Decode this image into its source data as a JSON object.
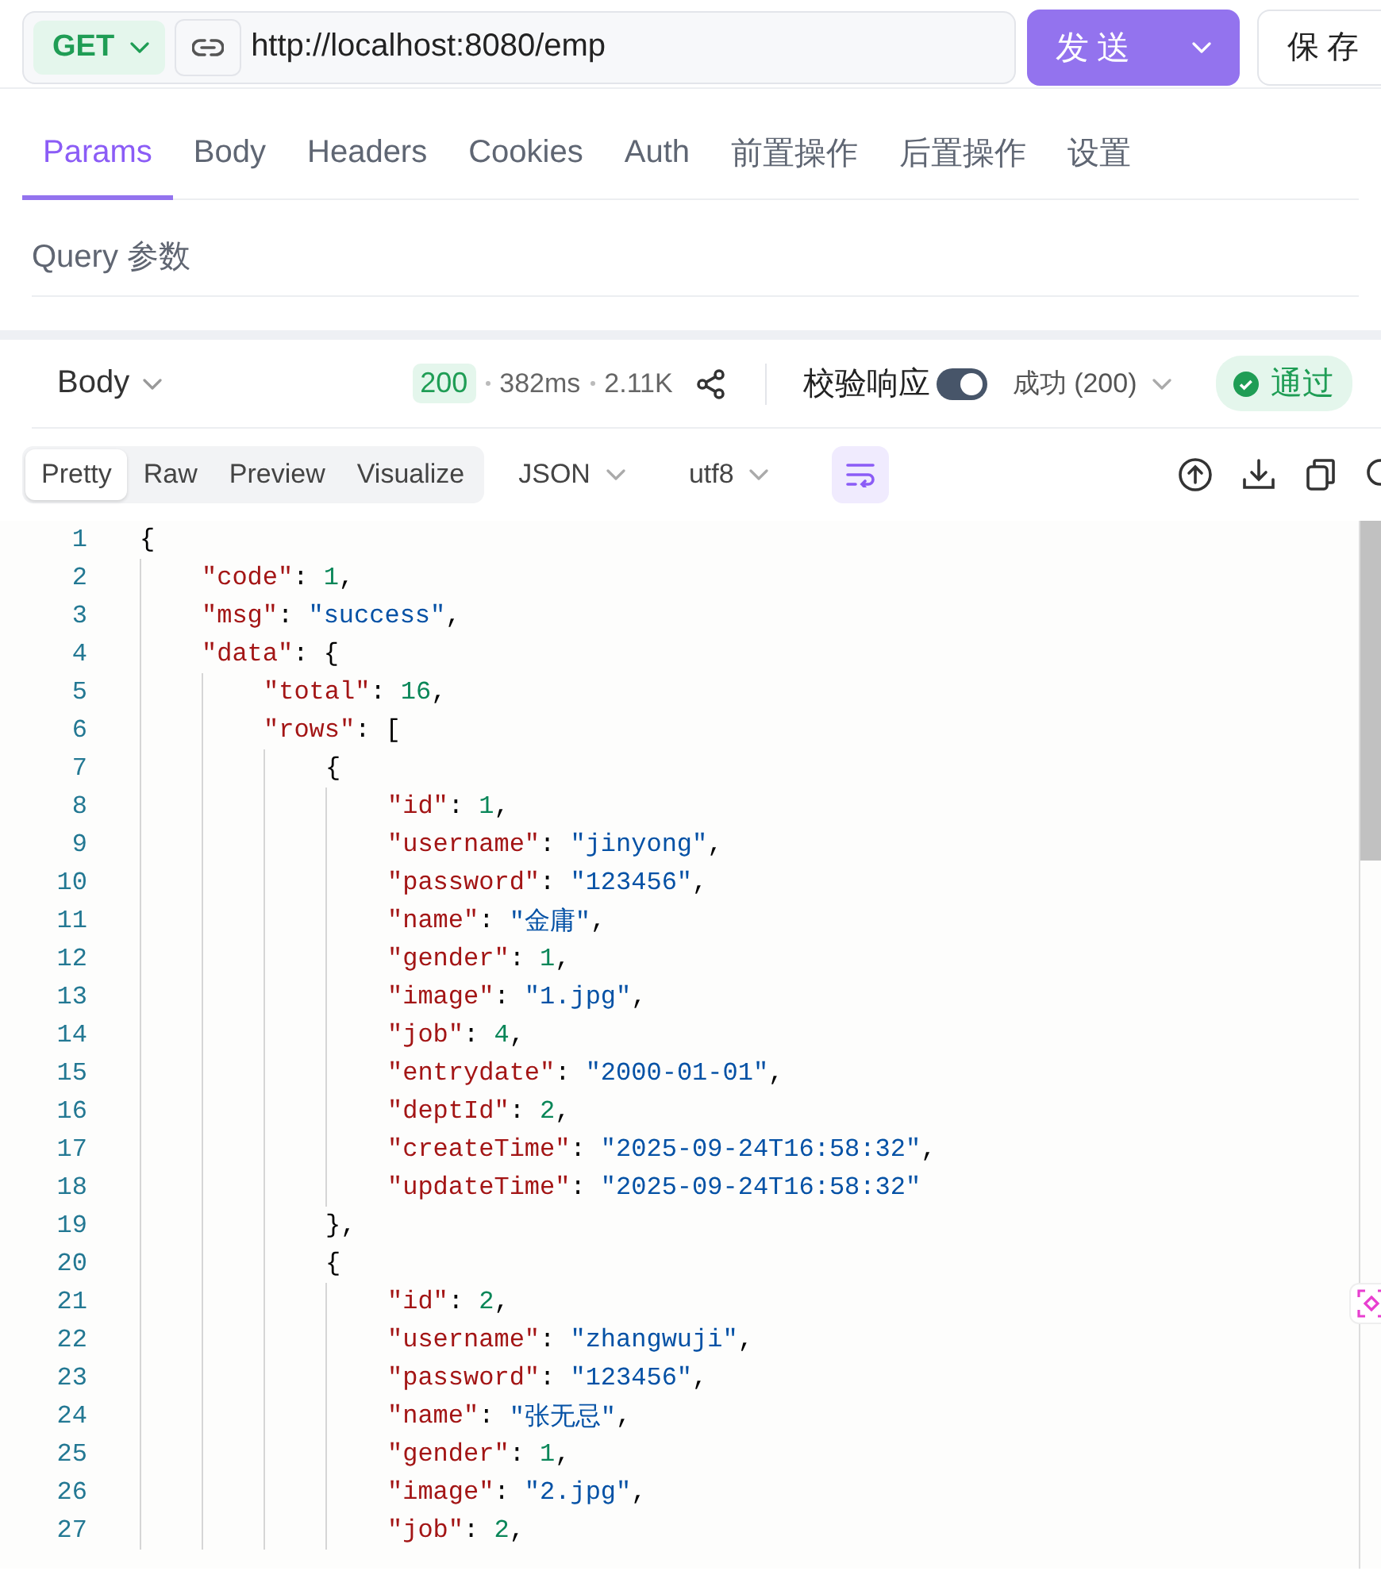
{
  "request": {
    "method": "GET",
    "url": "http://localhost:8080/emp",
    "send_label": "发送",
    "save_label": "保存"
  },
  "tabs": [
    {
      "label": "Params",
      "selected": true
    },
    {
      "label": "Body",
      "selected": false
    },
    {
      "label": "Headers",
      "selected": false
    },
    {
      "label": "Cookies",
      "selected": false
    },
    {
      "label": "Auth",
      "selected": false
    },
    {
      "label": "前置操作",
      "selected": false
    },
    {
      "label": "后置操作",
      "selected": false
    },
    {
      "label": "设置",
      "selected": false
    }
  ],
  "section_title": "Query 参数",
  "response": {
    "body_label": "Body",
    "status": "200",
    "time": "382ms",
    "size": "2.11K",
    "validate_label": "校验响应",
    "validate_on": true,
    "expect": "成功 (200)",
    "result": "通过"
  },
  "view_modes": [
    {
      "label": "Pretty",
      "selected": true
    },
    {
      "label": "Raw",
      "selected": false
    },
    {
      "label": "Preview",
      "selected": false
    },
    {
      "label": "Visualize",
      "selected": false
    }
  ],
  "format": "JSON",
  "encoding": "utf8",
  "wrap_on": true,
  "code_lines": [
    {
      "number": "1",
      "tokens": [
        {
          "kind": "punct",
          "text": "{"
        }
      ]
    },
    {
      "number": "2",
      "tokens": [
        {
          "kind": "key",
          "text": "\"code\""
        },
        {
          "kind": "punct",
          "text": ": "
        },
        {
          "kind": "number",
          "text": "1"
        },
        {
          "kind": "punct",
          "text": ","
        }
      ]
    },
    {
      "number": "3",
      "tokens": [
        {
          "kind": "key",
          "text": "\"msg\""
        },
        {
          "kind": "punct",
          "text": ": "
        },
        {
          "kind": "string",
          "text": "\"success\""
        },
        {
          "kind": "punct",
          "text": ","
        }
      ]
    },
    {
      "number": "4",
      "tokens": [
        {
          "kind": "key",
          "text": "\"data\""
        },
        {
          "kind": "punct",
          "text": ": {"
        }
      ]
    },
    {
      "number": "5",
      "tokens": [
        {
          "kind": "key",
          "text": "\"total\""
        },
        {
          "kind": "punct",
          "text": ": "
        },
        {
          "kind": "number",
          "text": "16"
        },
        {
          "kind": "punct",
          "text": ","
        }
      ]
    },
    {
      "number": "6",
      "tokens": [
        {
          "kind": "key",
          "text": "\"rows\""
        },
        {
          "kind": "punct",
          "text": ": ["
        }
      ]
    },
    {
      "number": "7",
      "tokens": [
        {
          "kind": "punct",
          "text": "{"
        }
      ]
    },
    {
      "number": "8",
      "tokens": [
        {
          "kind": "key",
          "text": "\"id\""
        },
        {
          "kind": "punct",
          "text": ": "
        },
        {
          "kind": "number",
          "text": "1"
        },
        {
          "kind": "punct",
          "text": ","
        }
      ]
    },
    {
      "number": "9",
      "tokens": [
        {
          "kind": "key",
          "text": "\"username\""
        },
        {
          "kind": "punct",
          "text": ": "
        },
        {
          "kind": "string",
          "text": "\"jinyong\""
        },
        {
          "kind": "punct",
          "text": ","
        }
      ]
    },
    {
      "number": "10",
      "tokens": [
        {
          "kind": "key",
          "text": "\"password\""
        },
        {
          "kind": "punct",
          "text": ": "
        },
        {
          "kind": "string",
          "text": "\"123456\""
        },
        {
          "kind": "punct",
          "text": ","
        }
      ]
    },
    {
      "number": "11",
      "tokens": [
        {
          "kind": "key",
          "text": "\"name\""
        },
        {
          "kind": "punct",
          "text": ": "
        },
        {
          "kind": "string",
          "text": "\"金庸\""
        },
        {
          "kind": "punct",
          "text": ","
        }
      ]
    },
    {
      "number": "12",
      "tokens": [
        {
          "kind": "key",
          "text": "\"gender\""
        },
        {
          "kind": "punct",
          "text": ": "
        },
        {
          "kind": "number",
          "text": "1"
        },
        {
          "kind": "punct",
          "text": ","
        }
      ]
    },
    {
      "number": "13",
      "tokens": [
        {
          "kind": "key",
          "text": "\"image\""
        },
        {
          "kind": "punct",
          "text": ": "
        },
        {
          "kind": "string",
          "text": "\"1.jpg\""
        },
        {
          "kind": "punct",
          "text": ","
        }
      ]
    },
    {
      "number": "14",
      "tokens": [
        {
          "kind": "key",
          "text": "\"job\""
        },
        {
          "kind": "punct",
          "text": ": "
        },
        {
          "kind": "number",
          "text": "4"
        },
        {
          "kind": "punct",
          "text": ","
        }
      ]
    },
    {
      "number": "15",
      "tokens": [
        {
          "kind": "key",
          "text": "\"entrydate\""
        },
        {
          "kind": "punct",
          "text": ": "
        },
        {
          "kind": "string",
          "text": "\"2000-01-01\""
        },
        {
          "kind": "punct",
          "text": ","
        }
      ]
    },
    {
      "number": "16",
      "tokens": [
        {
          "kind": "key",
          "text": "\"deptId\""
        },
        {
          "kind": "punct",
          "text": ": "
        },
        {
          "kind": "number",
          "text": "2"
        },
        {
          "kind": "punct",
          "text": ","
        }
      ]
    },
    {
      "number": "17",
      "tokens": [
        {
          "kind": "key",
          "text": "\"createTime\""
        },
        {
          "kind": "punct",
          "text": ": "
        },
        {
          "kind": "string",
          "text": "\"2025-09-24T16:58:32\""
        },
        {
          "kind": "punct",
          "text": ","
        }
      ]
    },
    {
      "number": "18",
      "tokens": [
        {
          "kind": "key",
          "text": "\"updateTime\""
        },
        {
          "kind": "punct",
          "text": ": "
        },
        {
          "kind": "string",
          "text": "\"2025-09-24T16:58:32\""
        }
      ]
    },
    {
      "number": "19",
      "tokens": [
        {
          "kind": "punct",
          "text": "},"
        }
      ]
    },
    {
      "number": "20",
      "tokens": [
        {
          "kind": "punct",
          "text": "{"
        }
      ]
    },
    {
      "number": "21",
      "tokens": [
        {
          "kind": "key",
          "text": "\"id\""
        },
        {
          "kind": "punct",
          "text": ": "
        },
        {
          "kind": "number",
          "text": "2"
        },
        {
          "kind": "punct",
          "text": ","
        }
      ]
    },
    {
      "number": "22",
      "tokens": [
        {
          "kind": "key",
          "text": "\"username\""
        },
        {
          "kind": "punct",
          "text": ": "
        },
        {
          "kind": "string",
          "text": "\"zhangwuji\""
        },
        {
          "kind": "punct",
          "text": ","
        }
      ]
    },
    {
      "number": "23",
      "tokens": [
        {
          "kind": "key",
          "text": "\"password\""
        },
        {
          "kind": "punct",
          "text": ": "
        },
        {
          "kind": "string",
          "text": "\"123456\""
        },
        {
          "kind": "punct",
          "text": ","
        }
      ]
    },
    {
      "number": "24",
      "tokens": [
        {
          "kind": "key",
          "text": "\"name\""
        },
        {
          "kind": "punct",
          "text": ": "
        },
        {
          "kind": "string",
          "text": "\"张无忌\""
        },
        {
          "kind": "punct",
          "text": ","
        }
      ]
    },
    {
      "number": "25",
      "tokens": [
        {
          "kind": "key",
          "text": "\"gender\""
        },
        {
          "kind": "punct",
          "text": ": "
        },
        {
          "kind": "number",
          "text": "1"
        },
        {
          "kind": "punct",
          "text": ","
        }
      ]
    },
    {
      "number": "26",
      "tokens": [
        {
          "kind": "key",
          "text": "\"image\""
        },
        {
          "kind": "punct",
          "text": ": "
        },
        {
          "kind": "string",
          "text": "\"2.jpg\""
        },
        {
          "kind": "punct",
          "text": ","
        }
      ]
    },
    {
      "number": "27",
      "tokens": [
        {
          "kind": "key",
          "text": "\"job\""
        },
        {
          "kind": "punct",
          "text": ": "
        },
        {
          "kind": "number",
          "text": "2"
        },
        {
          "kind": "punct",
          "text": ","
        }
      ]
    }
  ]
}
